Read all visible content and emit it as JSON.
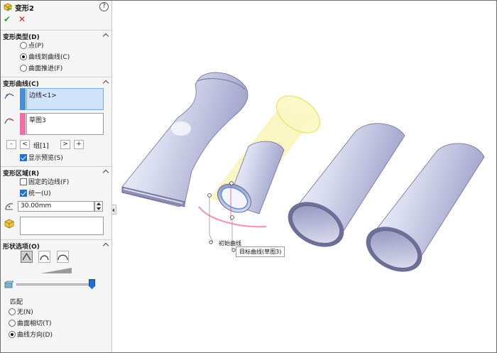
{
  "panel": {
    "title": "变形2",
    "help_icon": "?",
    "ok_icon": "✔",
    "cancel_icon": "✕"
  },
  "deform_type": {
    "header": "变形类型(D)",
    "options": [
      {
        "label": "点(P)",
        "selected": false
      },
      {
        "label": "曲线到曲线(C)",
        "selected": true
      },
      {
        "label": "曲面推进(F)",
        "selected": false
      }
    ]
  },
  "deform_curves": {
    "header": "变形曲线(C)",
    "initial_curve": "边线<1>",
    "target_curve": "草图3",
    "group_label": "组[1]",
    "prev_btn": "<",
    "next_btn": ">",
    "remove_btn": "-",
    "add_btn": "+",
    "show_preview": {
      "label": "显示预览(S)",
      "checked": true
    },
    "colors": {
      "initial": "#4a90d9",
      "target": "#f06fa6"
    }
  },
  "deform_region": {
    "header": "变形区域(R)",
    "fixed_edges": {
      "label": "固定的边线(F)",
      "checked": false
    },
    "uniform": {
      "label": "统一(U)",
      "checked": true
    },
    "radius_value": "30.00mm"
  },
  "shape_options": {
    "header": "形状选项(O)",
    "match_label": "匹配",
    "match_options": [
      {
        "label": "无(N)",
        "selected": false
      },
      {
        "label": "曲面相切(T)",
        "selected": false
      },
      {
        "label": "曲线方向(D)",
        "selected": true
      }
    ],
    "stiffness_fraction": 1.0
  },
  "viewport": {
    "initial_curve_callout": "初始曲线",
    "target_curve_callout": "目标曲线(草图3)"
  }
}
